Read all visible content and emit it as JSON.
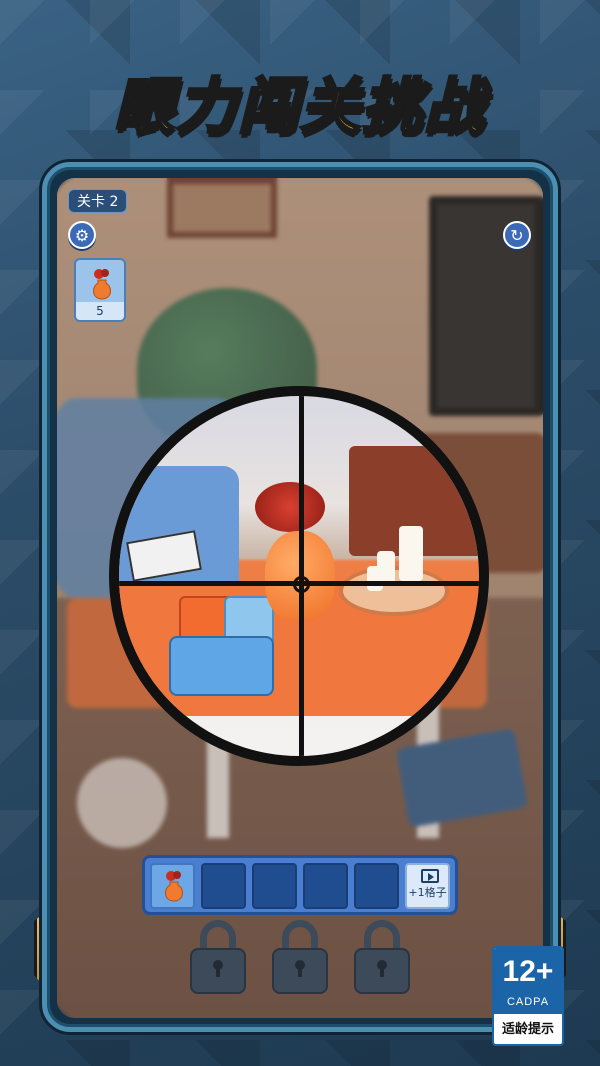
{
  "title": "眼力闯关挑战",
  "hud": {
    "level_label": "关卡 2",
    "settings_icon": "gear-icon",
    "refresh_icon": "refresh-icon",
    "target": {
      "icon": "vase-icon",
      "count": "5"
    }
  },
  "slots": {
    "items": [
      {
        "state": "filled",
        "icon": "vase-icon"
      },
      {
        "state": "empty"
      },
      {
        "state": "empty"
      },
      {
        "state": "empty"
      },
      {
        "state": "empty"
      }
    ],
    "add_button": {
      "icon": "video-icon",
      "label": "+1格子"
    }
  },
  "locks": [
    "lock-icon",
    "lock-icon",
    "lock-icon"
  ],
  "age_rating": {
    "age": "12+",
    "org": "CADPA",
    "tip": "适龄提示"
  },
  "colors": {
    "title": "#ffd83a",
    "frame": "#4c8fb3",
    "slot_bar": "#4a7ed0",
    "rating": "#1b64a8"
  }
}
